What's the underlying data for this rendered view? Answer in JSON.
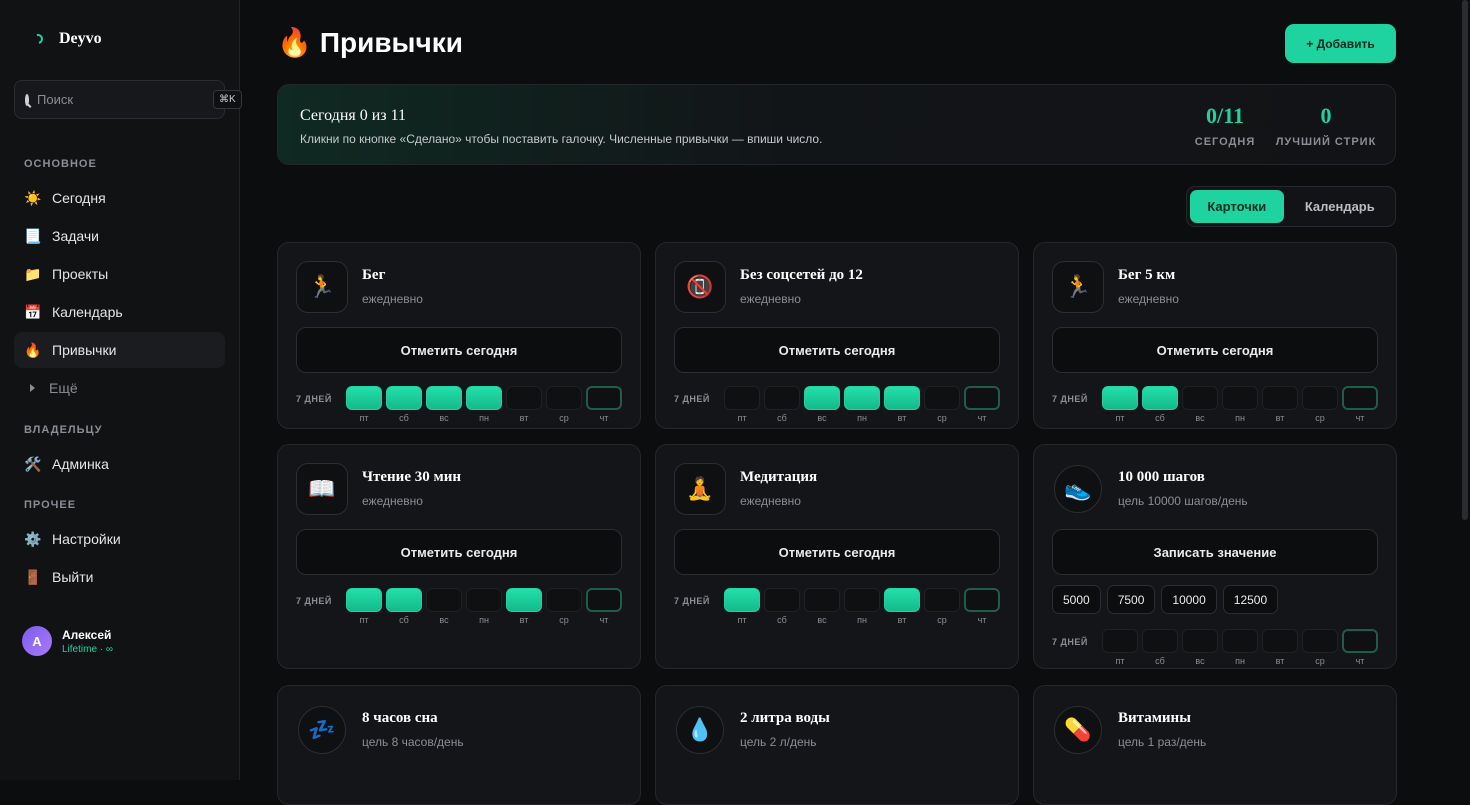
{
  "brand": {
    "name": "Deyvo"
  },
  "search": {
    "placeholder": "Поиск",
    "shortcut": "⌘K"
  },
  "sidebar": {
    "sections": [
      {
        "label": "ОСНОВНОЕ",
        "items": [
          {
            "label": "Сегодня",
            "icon": "☀️"
          },
          {
            "label": "Задачи",
            "icon": "📃"
          },
          {
            "label": "Проекты",
            "icon": "📁"
          },
          {
            "label": "Календарь",
            "icon": "📅"
          },
          {
            "label": "Привычки",
            "icon": "🔥"
          },
          {
            "label": "Ещё"
          }
        ]
      },
      {
        "label": "ВЛАДЕЛЬЦУ",
        "items": [
          {
            "label": "Админка",
            "icon": "🛠️"
          }
        ]
      },
      {
        "label": "ПРОЧЕЕ",
        "items": [
          {
            "label": "Настройки",
            "icon": "⚙️"
          },
          {
            "label": "Выйти",
            "icon": "🚪"
          }
        ]
      }
    ]
  },
  "user": {
    "initial": "А",
    "name": "Алексей",
    "plan": "Lifetime · ∞"
  },
  "page": {
    "icon": "🔥",
    "title": "Привычки",
    "add_label": "+ Добавить"
  },
  "summary": {
    "title": "Сегодня 0 из 11",
    "desc": "Кликни по кнопке «Сделано» чтобы поставить галочку. Численные привычки — впиши число.",
    "today_value": "0/11",
    "today_label": "СЕГОДНЯ",
    "streak_value": "0",
    "streak_label": "ЛУЧШИЙ СТРИК"
  },
  "view_toggle": {
    "cards": "Карточки",
    "calendar": "Календарь"
  },
  "week_label": "7 ДНЕЙ",
  "days": [
    "пт",
    "сб",
    "вс",
    "пн",
    "вт",
    "ср",
    "чт"
  ],
  "habits": [
    {
      "icon": "🏃",
      "name": "Бег",
      "freq": "ежедневно",
      "action": "Отметить сегодня",
      "done": [
        1,
        1,
        1,
        1,
        0,
        0,
        0
      ]
    },
    {
      "icon": "📵",
      "name": "Без соцсетей до 12",
      "freq": "ежедневно",
      "action": "Отметить сегодня",
      "done": [
        0,
        0,
        1,
        1,
        1,
        0,
        0
      ]
    },
    {
      "icon": "🏃",
      "name": "Бег 5 км",
      "freq": "ежедневно",
      "action": "Отметить сегодня",
      "done": [
        1,
        1,
        0,
        0,
        0,
        0,
        0
      ]
    },
    {
      "icon": "📖",
      "name": "Чтение 30 мин",
      "freq": "ежедневно",
      "action": "Отметить сегодня",
      "done": [
        1,
        1,
        0,
        0,
        1,
        0,
        0
      ]
    },
    {
      "icon": "🧘",
      "name": "Медитация",
      "freq": "ежедневно",
      "action": "Отметить сегодня",
      "done": [
        1,
        0,
        0,
        0,
        1,
        0,
        0
      ]
    },
    {
      "icon": "👟",
      "name": "10 000 шагов",
      "freq": "цель 10000 шагов/день",
      "action": "Записать значение",
      "chips": [
        "5000",
        "7500",
        "10000",
        "12500"
      ],
      "done": [
        0,
        0,
        0,
        0,
        0,
        0,
        0
      ]
    },
    {
      "icon": "💤",
      "name": "8 часов сна",
      "freq": "цель 8 часов/день"
    },
    {
      "icon": "💧",
      "name": "2 литра воды",
      "freq": "цель 2 л/день"
    },
    {
      "icon": "💊",
      "name": "Витамины",
      "freq": "цель 1 раз/день"
    }
  ]
}
